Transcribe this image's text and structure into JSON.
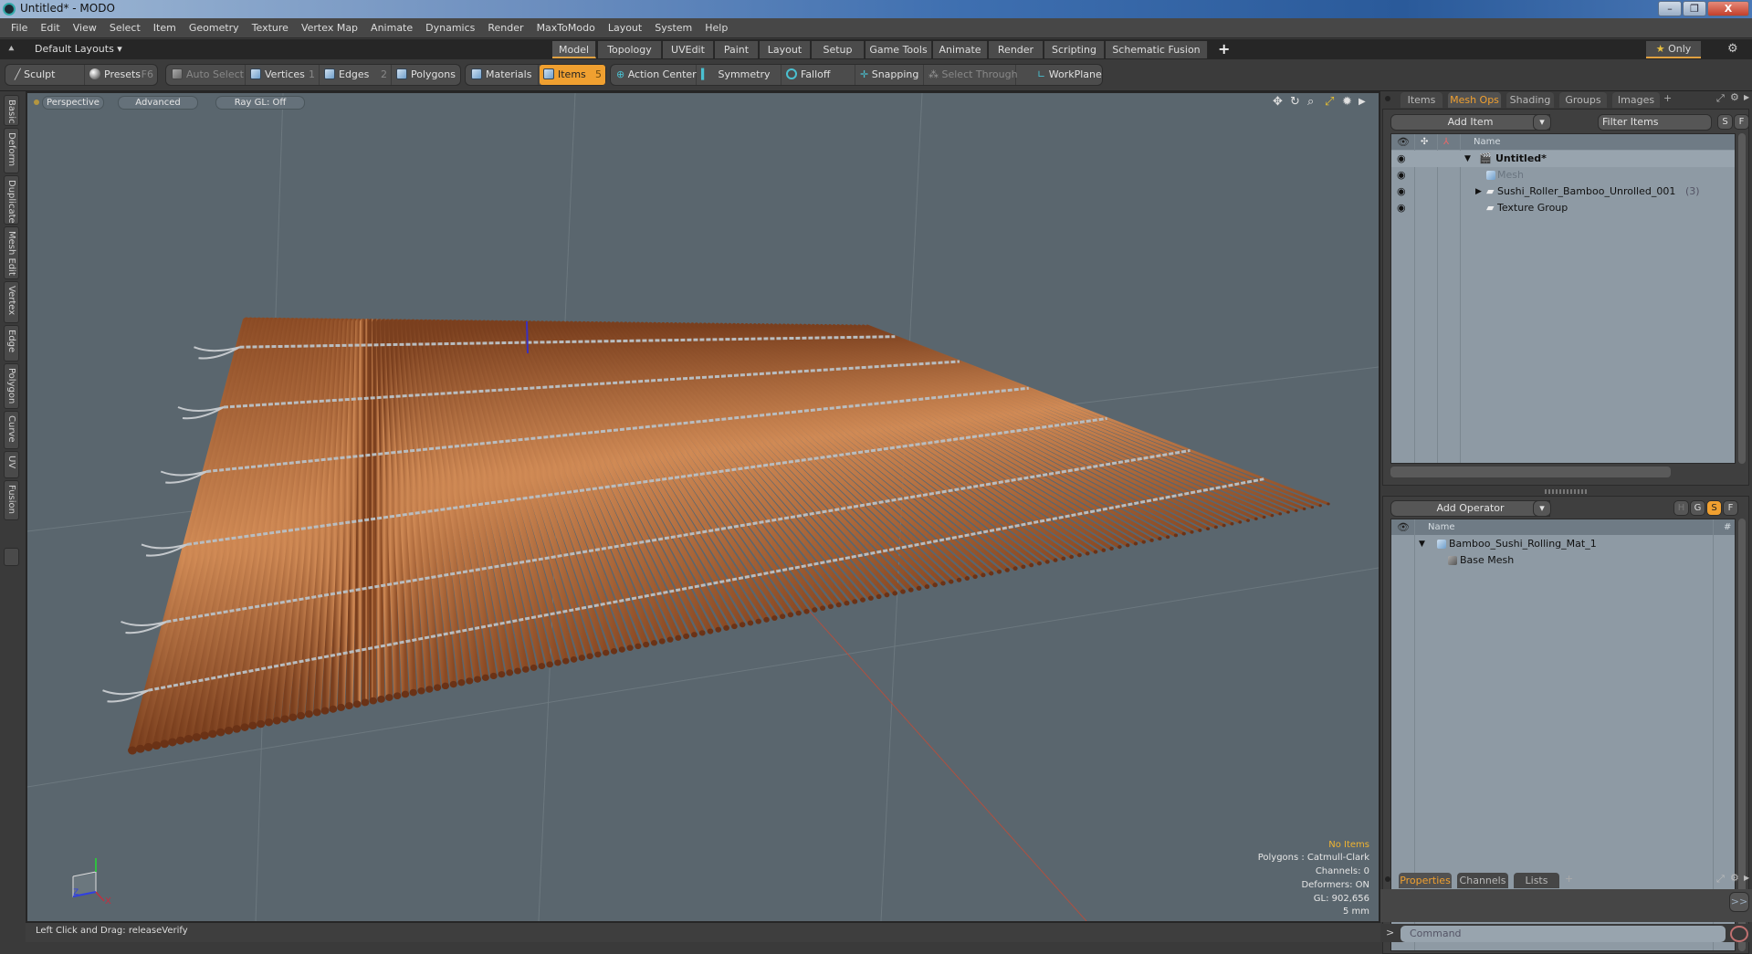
{
  "window": {
    "title": "Untitled* - MODO",
    "minimize": "–",
    "maximize": "❐",
    "close": "X"
  },
  "menu": [
    "File",
    "Edit",
    "View",
    "Select",
    "Item",
    "Geometry",
    "Texture",
    "Vertex Map",
    "Animate",
    "Dynamics",
    "Render",
    "MaxToModo",
    "Layout",
    "System",
    "Help"
  ],
  "layoutbar": {
    "layouts_label": "Default Layouts ▾",
    "tabs": [
      "Model",
      "Topology",
      "UVEdit",
      "Paint",
      "Layout",
      "Setup",
      "Game Tools",
      "Animate",
      "Render",
      "Scripting",
      "Schematic Fusion"
    ],
    "active_tab": "Model",
    "add": "+",
    "only_label": "Only",
    "star": "★",
    "gear": "⚙"
  },
  "toolbar": {
    "sculpt": "Sculpt",
    "presets": "Presets",
    "presets_key": "F6",
    "auto_select": "Auto Select",
    "vertices": "Vertices",
    "vertices_key": "1",
    "edges": "Edges",
    "edges_key": "2",
    "polygons": "Polygons",
    "materials": "Materials",
    "items": "Items",
    "items_key": "5",
    "action_center": "Action Center",
    "symmetry": "Symmetry",
    "falloff": "Falloff",
    "snapping": "Snapping",
    "select_through": "Select Through",
    "workplane": "WorkPlane"
  },
  "left_tabs": [
    "Basic",
    "Deform",
    "Duplicate",
    "Mesh Edit",
    "Vertex",
    "Edge",
    "Polygon",
    "Curve",
    "UV",
    "Fusion"
  ],
  "viewport": {
    "view_mode": "Perspective",
    "shading": "Advanced",
    "raygl": "Ray GL: Off",
    "info": {
      "selection": "No Items",
      "polygons": "Polygons : Catmull-Clark",
      "channels": "Channels: 0",
      "deformers": "Deformers: ON",
      "gl": "GL: 902,656",
      "scale": "5 mm"
    },
    "axis": {
      "x": "X",
      "z": "Z"
    }
  },
  "status": {
    "text": "Left Click and Drag:   releaseVerify"
  },
  "items_panel": {
    "tabs": [
      "Items",
      "Mesh Ops",
      "Shading",
      "Groups",
      "Images"
    ],
    "active_tab": "Mesh Ops",
    "add_tab": "+",
    "add_item": "Add Item",
    "filter_placeholder": "Filter Items",
    "s_btn": "S",
    "f_btn": "F",
    "col_name": "Name",
    "rows": [
      {
        "name": "Untitled*",
        "count": ""
      },
      {
        "name": "Mesh",
        "count": ""
      },
      {
        "name": "Sushi_Roller_Bamboo_Unrolled_001",
        "count": "(3)"
      },
      {
        "name": "Texture Group",
        "count": ""
      }
    ]
  },
  "meshops_panel": {
    "add_operator": "Add Operator",
    "h_btn": "H",
    "g_btn": "G",
    "s_btn": "S",
    "f_btn": "F",
    "col_name": "Name",
    "col_count": "#",
    "rows": [
      {
        "name": "Bamboo_Sushi_Rolling_Mat_1"
      },
      {
        "name": "Base Mesh"
      }
    ]
  },
  "props_panel": {
    "tabs": [
      "Properties",
      "Channels",
      "Lists"
    ],
    "active_tab": "Properties",
    "add_tab": "+",
    "expand": ">>"
  },
  "command": {
    "prompt": ">",
    "placeholder": "Command"
  },
  "colors": {
    "accent": "#f0a030",
    "viewport_bg": "#5a666e",
    "bamboo": "#b8703e",
    "rope": "#b9bdc0"
  }
}
